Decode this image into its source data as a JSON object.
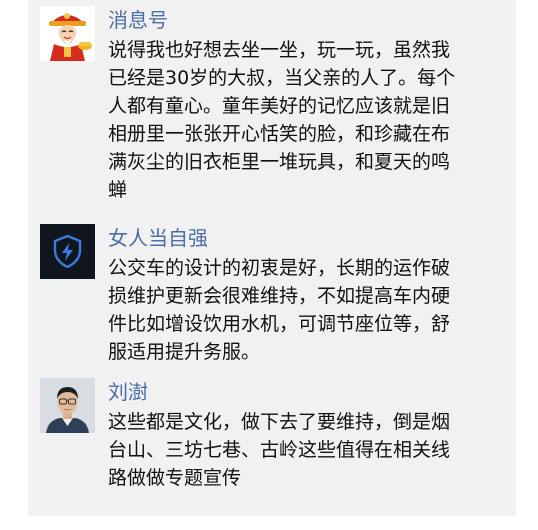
{
  "comments": [
    {
      "user": "消息号",
      "lines": [
        "说得我也好想去坐一坐，玩一玩，虽然我",
        "已经是30岁的大叔，当父亲的人了。每个",
        "人都有童心。童年美好的记忆应该就是旧",
        "相册里一张张开心恬笑的脸，和珍藏在布",
        "满灰尘的旧衣柜里一堆玩具，和夏天的鸣",
        "蝉"
      ],
      "avatar_icon": "fortune-god-avatar-icon"
    },
    {
      "user": "女人当自强",
      "lines": [
        "公交车的设计的初衷是好，长期的运作破",
        "损维护更新会很难维持，不如提高车内硬",
        "件比如增设饮用水机，可调节座位等，舒",
        "服适用提升务服。"
      ],
      "avatar_icon": "shield-lightning-icon"
    },
    {
      "user": "刘澍",
      "lines": [
        "这些都是文化，做下去了要维持，倒是烟",
        "台山、三坊七巷、古岭这些值得在相关线",
        "路做做专题宣传"
      ],
      "avatar_icon": "person-photo-avatar"
    }
  ],
  "colors": {
    "username": "#4a6ea5",
    "text": "#111111",
    "panel": "#f1f1f1",
    "shield_icon": "#3b7be0"
  }
}
